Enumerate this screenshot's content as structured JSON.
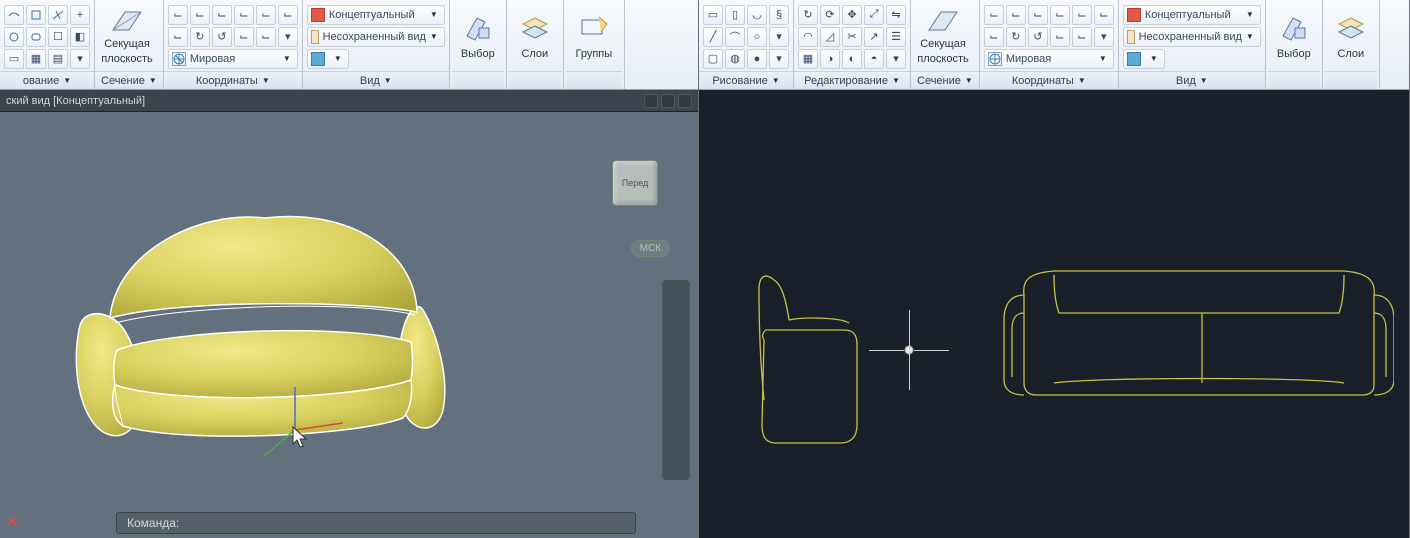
{
  "left": {
    "ribbon": {
      "groups": {
        "draw": {
          "footer": "ование"
        },
        "section": {
          "footer": "Сечение",
          "big1": "Секущая",
          "big2": "плоскость"
        },
        "coords": {
          "footer": "Координаты",
          "wide": "Мировая"
        },
        "view": {
          "footer": "Вид",
          "wide1": "Концептуальный",
          "wide2": "Несохраненный вид"
        },
        "select": {
          "label": "Выбор"
        },
        "layers": {
          "label": "Слои"
        },
        "groupsP": {
          "label": "Группы"
        }
      }
    },
    "doc": {
      "title": "ский вид [Концептуальный]"
    },
    "viewcube": "Перед",
    "mck": "МСК",
    "command": "Команда:"
  },
  "right": {
    "ribbon": {
      "groups": {
        "draw": {
          "footer": "Рисование"
        },
        "edit": {
          "footer": "Редактирование"
        },
        "section": {
          "footer": "Сечение",
          "big1": "Секущая",
          "big2": "плоскость"
        },
        "coords": {
          "footer": "Координаты",
          "wide": "Мировая"
        },
        "view": {
          "footer": "Вид",
          "wide1": "Концептуальный",
          "wide2": "Несохраненный вид"
        },
        "select": {
          "label": "Выбор"
        },
        "layers": {
          "label": "Слои"
        }
      }
    }
  }
}
